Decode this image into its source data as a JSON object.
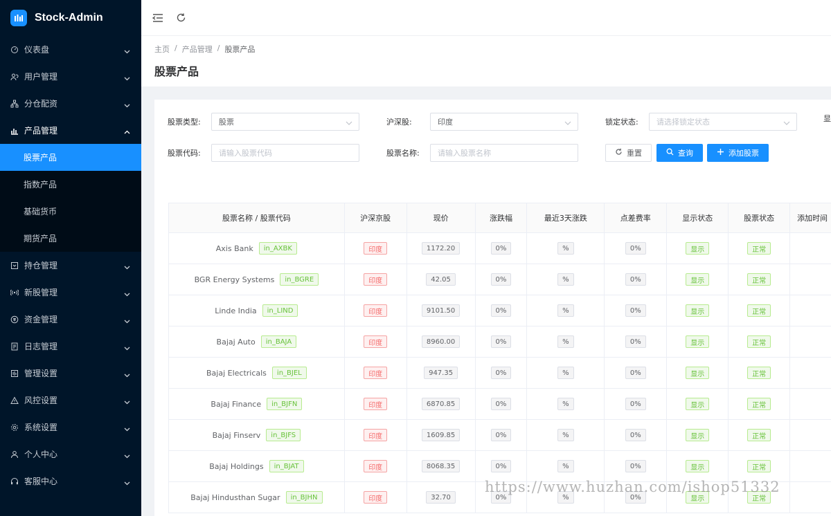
{
  "app": {
    "title": "Stock-Admin"
  },
  "sidebar": {
    "items": [
      {
        "label": "仪表盘",
        "icon": "dashboard-icon"
      },
      {
        "label": "用户管理",
        "icon": "users-icon"
      },
      {
        "label": "分仓配资",
        "icon": "sitemap-icon"
      },
      {
        "label": "产品管理",
        "icon": "chart-icon",
        "open": true
      },
      {
        "label": "持仓管理",
        "icon": "holdings-icon"
      },
      {
        "label": "新股管理",
        "icon": "signal-icon"
      },
      {
        "label": "资金管理",
        "icon": "money-icon"
      },
      {
        "label": "日志管理",
        "icon": "log-icon"
      },
      {
        "label": "管理设置",
        "icon": "settings-panel-icon"
      },
      {
        "label": "风控设置",
        "icon": "warning-icon"
      },
      {
        "label": "系统设置",
        "icon": "gear-icon"
      },
      {
        "label": "个人中心",
        "icon": "user-icon"
      },
      {
        "label": "客服中心",
        "icon": "headset-icon"
      }
    ],
    "product_sub": [
      "股票产品",
      "指数产品",
      "基础货币",
      "期货产品"
    ]
  },
  "breadcrumb": [
    "主页",
    "/",
    "产品管理",
    "/",
    "股票产品"
  ],
  "page_title": "股票产品",
  "filters": {
    "type_label": "股票类型:",
    "type_value": "股票",
    "market_label": "沪深股:",
    "market_value": "印度",
    "lock_label": "锁定状态:",
    "lock_placeholder": "请选择锁定状态",
    "show_label": "显",
    "code_label": "股票代码:",
    "code_placeholder": "请输入股票代码",
    "name_label": "股票名称:",
    "name_placeholder": "请输入股票名称"
  },
  "buttons": {
    "reset": "重置",
    "search": "查询",
    "add": "添加股票"
  },
  "table": {
    "headers": [
      "股票名称 / 股票代码",
      "沪深京股",
      "现价",
      "涨跌幅",
      "最近3天涨跌",
      "点差费率",
      "显示状态",
      "股票状态",
      "添加时间"
    ],
    "rows": [
      {
        "name": "Axis Bank",
        "code": "in_AXBK",
        "market": "印度",
        "price": "1172.20",
        "change": "0%",
        "three_day": "%",
        "spread": "0%",
        "show": "显示",
        "status": "正常"
      },
      {
        "name": "BGR Energy Systems",
        "code": "in_BGRE",
        "market": "印度",
        "price": "42.05",
        "change": "0%",
        "three_day": "%",
        "spread": "0%",
        "show": "显示",
        "status": "正常"
      },
      {
        "name": "Linde India",
        "code": "in_LIND",
        "market": "印度",
        "price": "9101.50",
        "change": "0%",
        "three_day": "%",
        "spread": "0%",
        "show": "显示",
        "status": "正常"
      },
      {
        "name": "Bajaj Auto",
        "code": "in_BAJA",
        "market": "印度",
        "price": "8960.00",
        "change": "0%",
        "three_day": "%",
        "spread": "0%",
        "show": "显示",
        "status": "正常"
      },
      {
        "name": "Bajaj Electricals",
        "code": "in_BJEL",
        "market": "印度",
        "price": "947.35",
        "change": "0%",
        "three_day": "%",
        "spread": "0%",
        "show": "显示",
        "status": "正常"
      },
      {
        "name": "Bajaj Finance",
        "code": "in_BJFN",
        "market": "印度",
        "price": "6870.85",
        "change": "0%",
        "three_day": "%",
        "spread": "0%",
        "show": "显示",
        "status": "正常"
      },
      {
        "name": "Bajaj Finserv",
        "code": "in_BJFS",
        "market": "印度",
        "price": "1609.85",
        "change": "0%",
        "three_day": "%",
        "spread": "0%",
        "show": "显示",
        "status": "正常"
      },
      {
        "name": "Bajaj Holdings",
        "code": "in_BJAT",
        "market": "印度",
        "price": "8068.35",
        "change": "0%",
        "three_day": "%",
        "spread": "0%",
        "show": "显示",
        "status": "正常"
      },
      {
        "name": "Bajaj Hindusthan Sugar",
        "code": "in_BJHN",
        "market": "印度",
        "price": "32.70",
        "change": "0%",
        "three_day": "%",
        "spread": "0%",
        "show": "显示",
        "status": "正常"
      }
    ]
  },
  "watermark": "https://www.huzhan.com/ishop51332",
  "colors": {
    "sidebar_bg": "#001529",
    "accent": "#1890ff",
    "red_tag": "#f56c6c",
    "green_tag": "#67c23a"
  }
}
